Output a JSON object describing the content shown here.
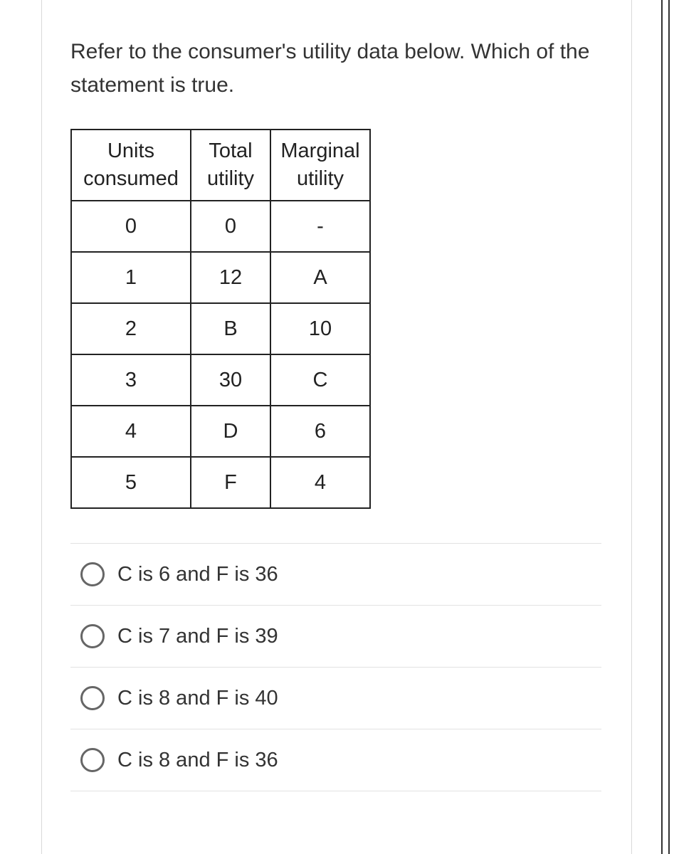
{
  "question": "Refer to the consumer's utility data below. Which of the statement is true.",
  "table": {
    "headers": [
      "Units consumed",
      "Total utility",
      "Marginal utility"
    ],
    "rows": [
      {
        "c0": "0",
        "c1": "0",
        "c2": "-"
      },
      {
        "c0": "1",
        "c1": "12",
        "c2": "A"
      },
      {
        "c0": "2",
        "c1": "B",
        "c2": "10"
      },
      {
        "c0": "3",
        "c1": "30",
        "c2": "C"
      },
      {
        "c0": "4",
        "c1": "D",
        "c2": "6"
      },
      {
        "c0": "5",
        "c1": "F",
        "c2": "4"
      }
    ]
  },
  "options": [
    "C is 6 and F is 36",
    "C is 7 and F is 39",
    "C is 8 and F is 40",
    "C is 8 and F is 36"
  ]
}
